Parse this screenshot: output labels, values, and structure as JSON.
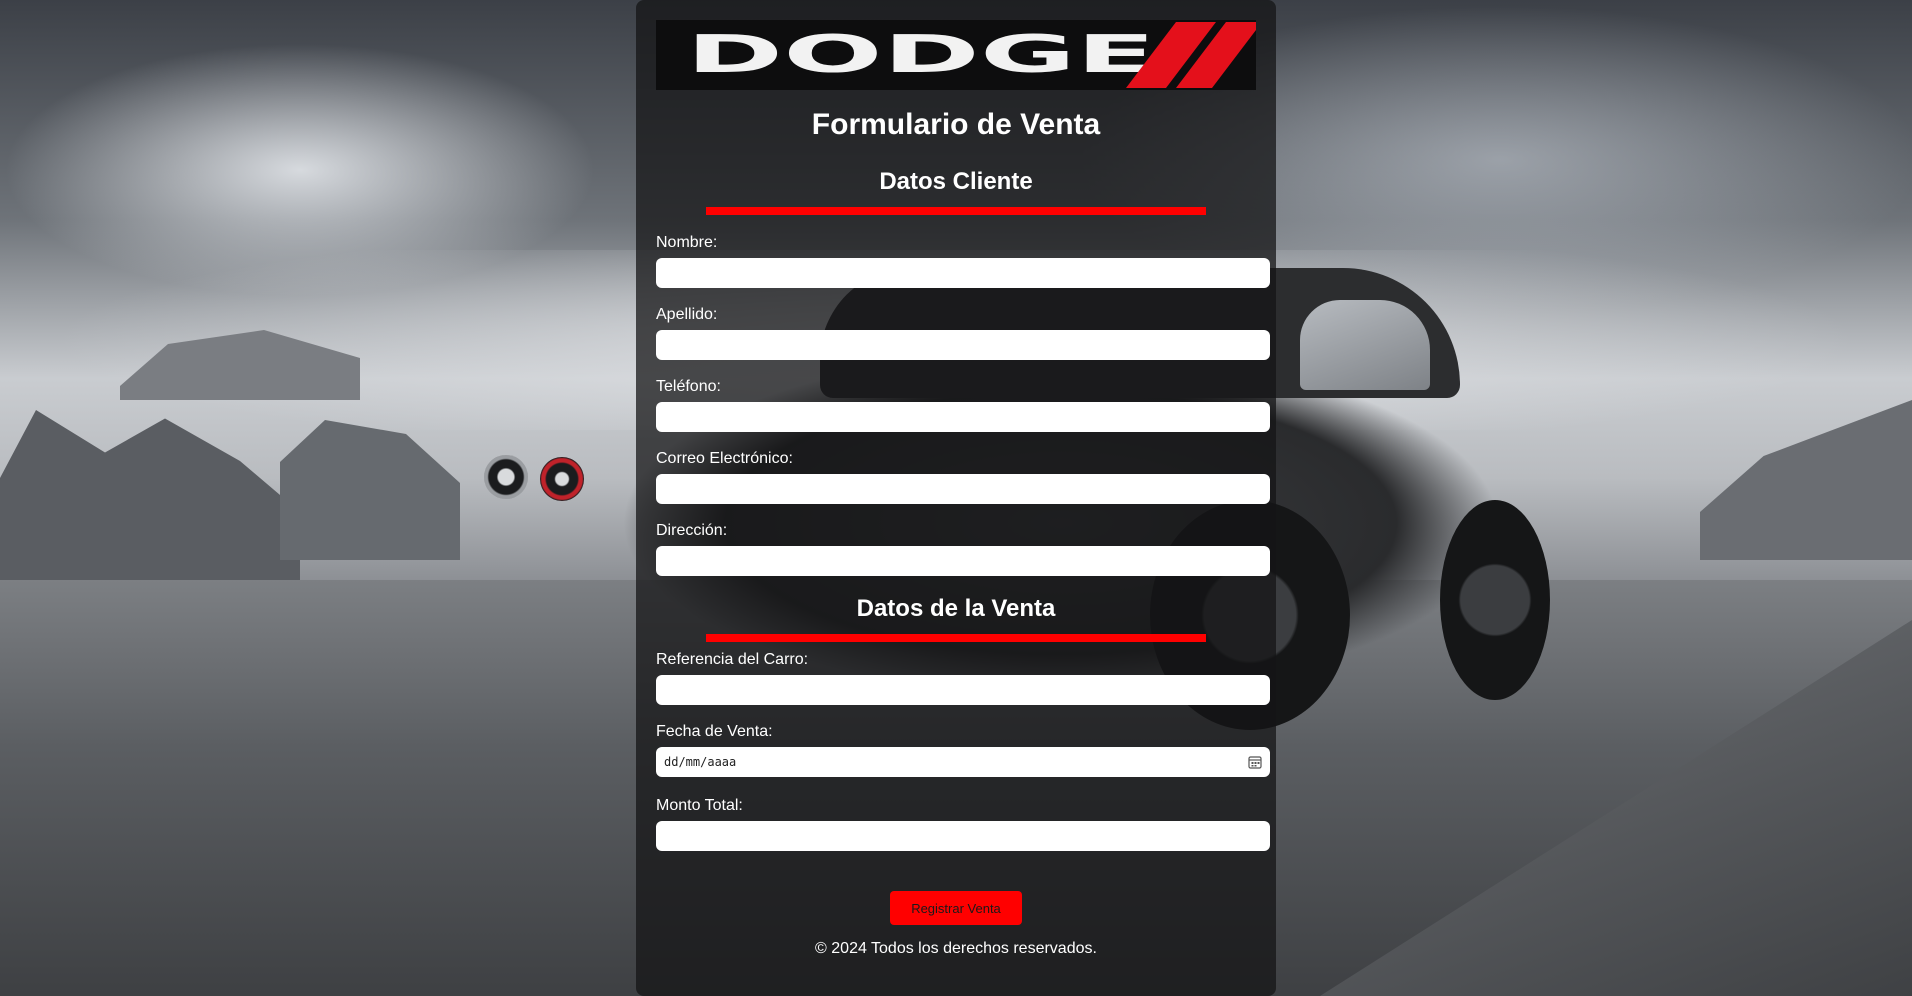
{
  "brand": {
    "logo_text": "DODGE"
  },
  "form": {
    "title": "Formulario de Venta",
    "section_client": "Datos Cliente",
    "section_sale": "Datos de la Venta",
    "fields": {
      "nombre": {
        "label": "Nombre:",
        "value": ""
      },
      "apellido": {
        "label": "Apellido:",
        "value": ""
      },
      "telefono": {
        "label": "Teléfono:",
        "value": ""
      },
      "correo": {
        "label": "Correo Electrónico:",
        "value": ""
      },
      "direccion": {
        "label": "Dirección:",
        "value": ""
      },
      "referencia": {
        "label": "Referencia del Carro:",
        "value": ""
      },
      "fecha": {
        "label": "Fecha de Venta:",
        "placeholder": "dd/mm/aaaa"
      },
      "monto": {
        "label": "Monto Total:",
        "value": ""
      }
    },
    "submit_label": "Registrar Venta"
  },
  "footer": {
    "text": "© 2024 Todos los derechos reservados."
  },
  "colors": {
    "accent": "#ff0000",
    "panel": "#141415",
    "text": "#ffffff"
  },
  "icons": {
    "date": "calendar-icon"
  }
}
